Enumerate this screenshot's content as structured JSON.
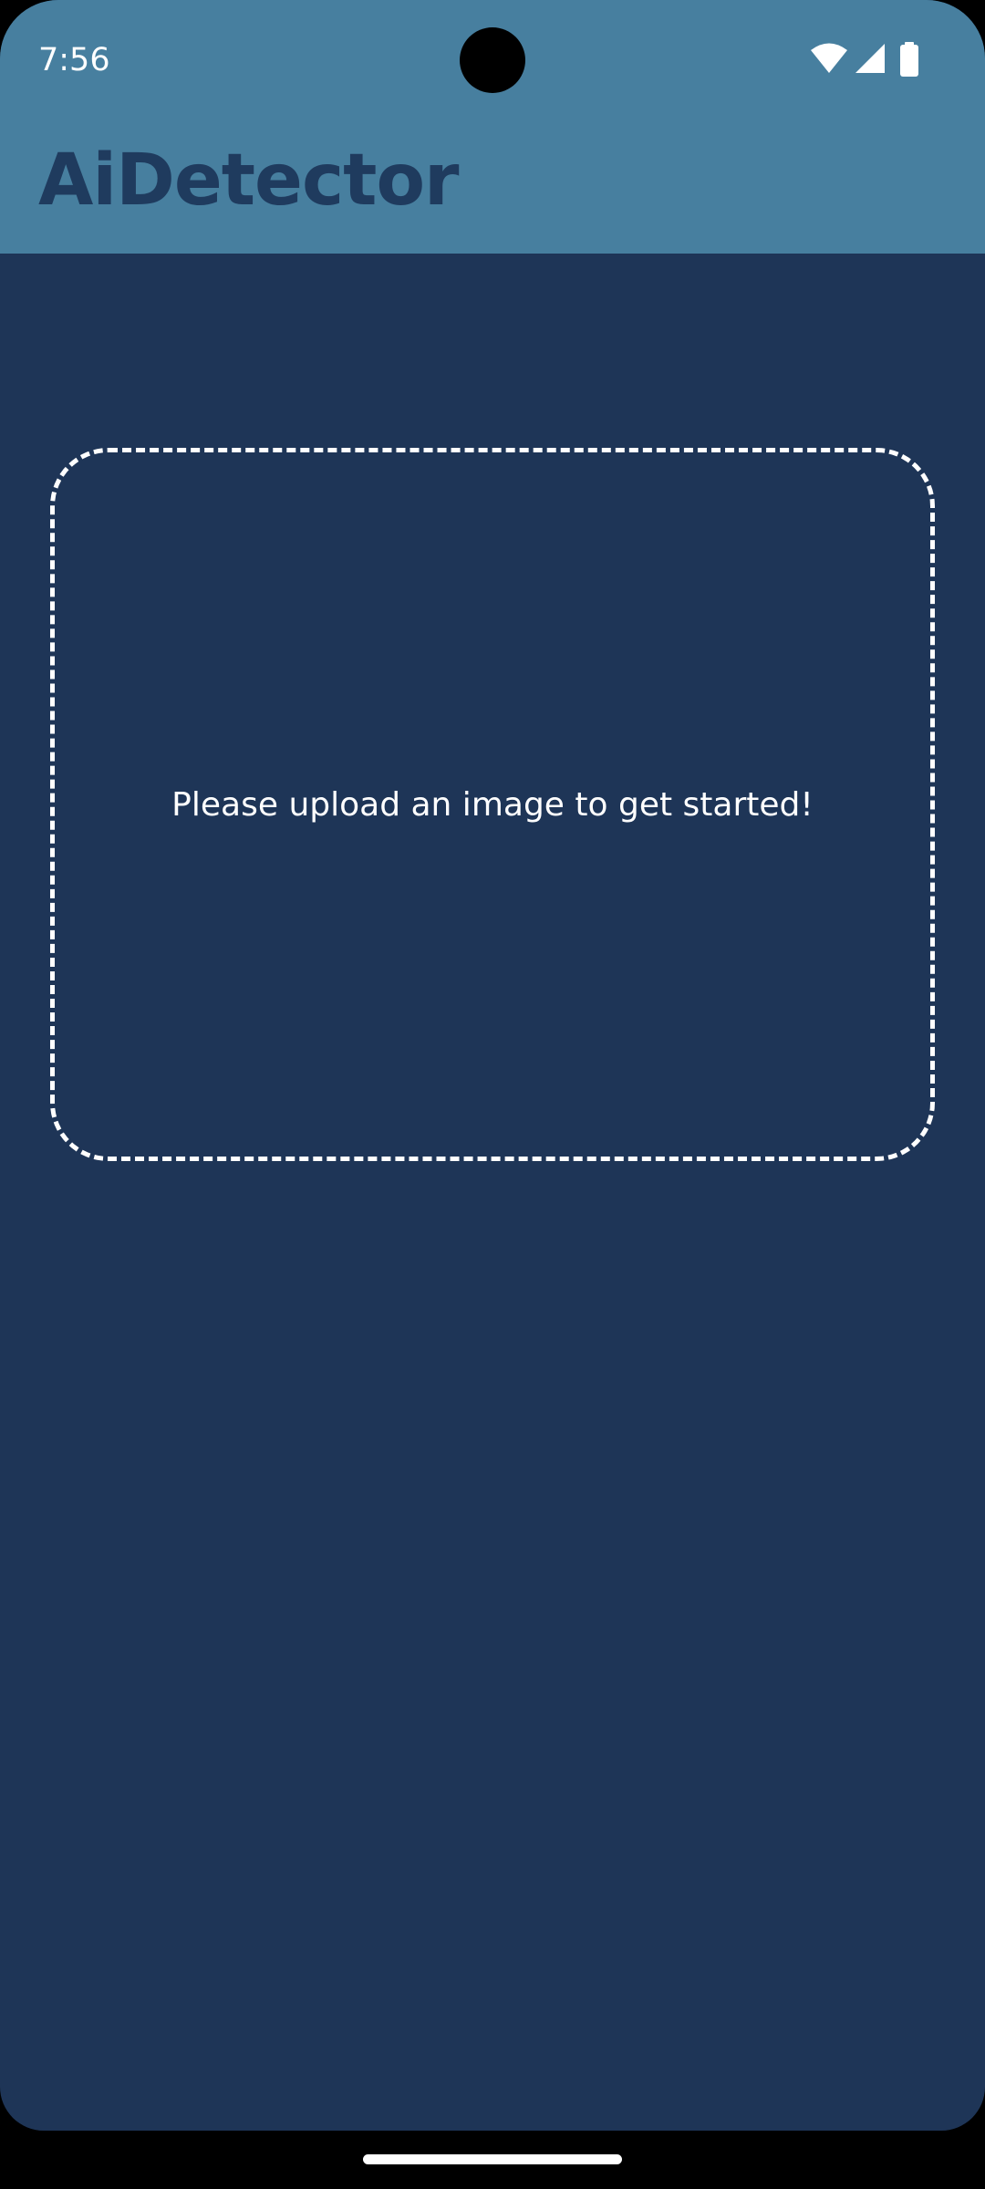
{
  "status_bar": {
    "time": "7:56",
    "icons": [
      "wifi-icon",
      "cellular-signal-icon",
      "battery-icon"
    ]
  },
  "app_bar": {
    "title": "AiDetector"
  },
  "upload": {
    "prompt": "Please upload an image to get started!"
  },
  "colors": {
    "app_bar_bg": "#477f9f",
    "screen_bg": "#1e3557",
    "title_text": "#1f3b5e",
    "foreground": "#ffffff"
  }
}
